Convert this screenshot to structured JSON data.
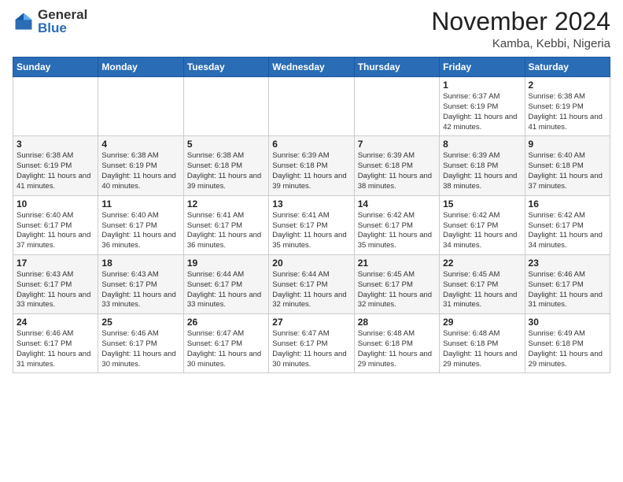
{
  "header": {
    "logo_general": "General",
    "logo_blue": "Blue",
    "month_title": "November 2024",
    "location": "Kamba, Kebbi, Nigeria"
  },
  "days_of_week": [
    "Sunday",
    "Monday",
    "Tuesday",
    "Wednesday",
    "Thursday",
    "Friday",
    "Saturday"
  ],
  "weeks": [
    [
      {
        "num": "",
        "info": ""
      },
      {
        "num": "",
        "info": ""
      },
      {
        "num": "",
        "info": ""
      },
      {
        "num": "",
        "info": ""
      },
      {
        "num": "",
        "info": ""
      },
      {
        "num": "1",
        "info": "Sunrise: 6:37 AM\nSunset: 6:19 PM\nDaylight: 11 hours and 42 minutes."
      },
      {
        "num": "2",
        "info": "Sunrise: 6:38 AM\nSunset: 6:19 PM\nDaylight: 11 hours and 41 minutes."
      }
    ],
    [
      {
        "num": "3",
        "info": "Sunrise: 6:38 AM\nSunset: 6:19 PM\nDaylight: 11 hours and 41 minutes."
      },
      {
        "num": "4",
        "info": "Sunrise: 6:38 AM\nSunset: 6:19 PM\nDaylight: 11 hours and 40 minutes."
      },
      {
        "num": "5",
        "info": "Sunrise: 6:38 AM\nSunset: 6:18 PM\nDaylight: 11 hours and 39 minutes."
      },
      {
        "num": "6",
        "info": "Sunrise: 6:39 AM\nSunset: 6:18 PM\nDaylight: 11 hours and 39 minutes."
      },
      {
        "num": "7",
        "info": "Sunrise: 6:39 AM\nSunset: 6:18 PM\nDaylight: 11 hours and 38 minutes."
      },
      {
        "num": "8",
        "info": "Sunrise: 6:39 AM\nSunset: 6:18 PM\nDaylight: 11 hours and 38 minutes."
      },
      {
        "num": "9",
        "info": "Sunrise: 6:40 AM\nSunset: 6:18 PM\nDaylight: 11 hours and 37 minutes."
      }
    ],
    [
      {
        "num": "10",
        "info": "Sunrise: 6:40 AM\nSunset: 6:17 PM\nDaylight: 11 hours and 37 minutes."
      },
      {
        "num": "11",
        "info": "Sunrise: 6:40 AM\nSunset: 6:17 PM\nDaylight: 11 hours and 36 minutes."
      },
      {
        "num": "12",
        "info": "Sunrise: 6:41 AM\nSunset: 6:17 PM\nDaylight: 11 hours and 36 minutes."
      },
      {
        "num": "13",
        "info": "Sunrise: 6:41 AM\nSunset: 6:17 PM\nDaylight: 11 hours and 35 minutes."
      },
      {
        "num": "14",
        "info": "Sunrise: 6:42 AM\nSunset: 6:17 PM\nDaylight: 11 hours and 35 minutes."
      },
      {
        "num": "15",
        "info": "Sunrise: 6:42 AM\nSunset: 6:17 PM\nDaylight: 11 hours and 34 minutes."
      },
      {
        "num": "16",
        "info": "Sunrise: 6:42 AM\nSunset: 6:17 PM\nDaylight: 11 hours and 34 minutes."
      }
    ],
    [
      {
        "num": "17",
        "info": "Sunrise: 6:43 AM\nSunset: 6:17 PM\nDaylight: 11 hours and 33 minutes."
      },
      {
        "num": "18",
        "info": "Sunrise: 6:43 AM\nSunset: 6:17 PM\nDaylight: 11 hours and 33 minutes."
      },
      {
        "num": "19",
        "info": "Sunrise: 6:44 AM\nSunset: 6:17 PM\nDaylight: 11 hours and 33 minutes."
      },
      {
        "num": "20",
        "info": "Sunrise: 6:44 AM\nSunset: 6:17 PM\nDaylight: 11 hours and 32 minutes."
      },
      {
        "num": "21",
        "info": "Sunrise: 6:45 AM\nSunset: 6:17 PM\nDaylight: 11 hours and 32 minutes."
      },
      {
        "num": "22",
        "info": "Sunrise: 6:45 AM\nSunset: 6:17 PM\nDaylight: 11 hours and 31 minutes."
      },
      {
        "num": "23",
        "info": "Sunrise: 6:46 AM\nSunset: 6:17 PM\nDaylight: 11 hours and 31 minutes."
      }
    ],
    [
      {
        "num": "24",
        "info": "Sunrise: 6:46 AM\nSunset: 6:17 PM\nDaylight: 11 hours and 31 minutes."
      },
      {
        "num": "25",
        "info": "Sunrise: 6:46 AM\nSunset: 6:17 PM\nDaylight: 11 hours and 30 minutes."
      },
      {
        "num": "26",
        "info": "Sunrise: 6:47 AM\nSunset: 6:17 PM\nDaylight: 11 hours and 30 minutes."
      },
      {
        "num": "27",
        "info": "Sunrise: 6:47 AM\nSunset: 6:17 PM\nDaylight: 11 hours and 30 minutes."
      },
      {
        "num": "28",
        "info": "Sunrise: 6:48 AM\nSunset: 6:18 PM\nDaylight: 11 hours and 29 minutes."
      },
      {
        "num": "29",
        "info": "Sunrise: 6:48 AM\nSunset: 6:18 PM\nDaylight: 11 hours and 29 minutes."
      },
      {
        "num": "30",
        "info": "Sunrise: 6:49 AM\nSunset: 6:18 PM\nDaylight: 11 hours and 29 minutes."
      }
    ]
  ]
}
